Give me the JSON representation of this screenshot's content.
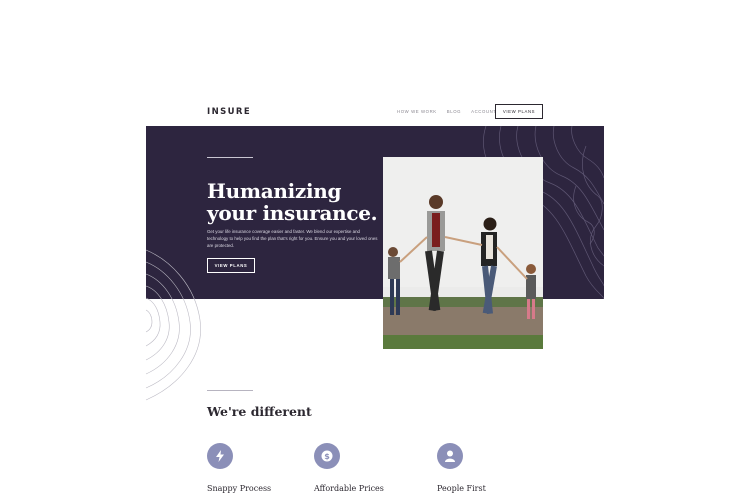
{
  "header": {
    "logo": "INSURE",
    "nav": [
      "HOW WE WORK",
      "BLOG",
      "ACCOUNT"
    ],
    "cta": "VIEW PLANS"
  },
  "hero": {
    "title": "Humanizing your insurance.",
    "text": "Get your life insurance coverage easier and faster. We blend our expertise and technology to help you find the plan that's right for you. Ensure you and your loved ones are protected.",
    "cta": "VIEW PLANS",
    "image_alt": "Family holding hands walking"
  },
  "features": {
    "title": "We're different",
    "items": [
      {
        "title": "Snappy Process",
        "icon": "lightning-icon"
      },
      {
        "title": "Affordable Prices",
        "icon": "dollar-icon"
      },
      {
        "title": "People First",
        "icon": "person-icon"
      }
    ]
  },
  "colors": {
    "hero_bg": "#2d253f",
    "accent": "#8b8fb8",
    "text_dark": "#2c2830"
  }
}
